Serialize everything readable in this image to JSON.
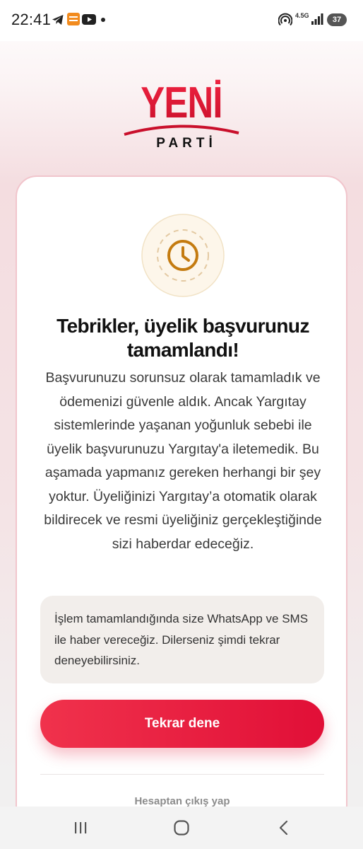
{
  "status_bar": {
    "time": "22:41",
    "network": "4.5G",
    "battery": "37",
    "icons": [
      "telegram-icon",
      "app-notification-icon",
      "youtube-icon",
      "hotspot-icon",
      "signal-icon"
    ]
  },
  "brand": {
    "name_top": "YENİ",
    "name_bottom": "PARTİ",
    "accent": "#e11d3a"
  },
  "card": {
    "status_icon": "clock-icon",
    "title": "Tebrikler, üyelik başvurunuz tamamlandı!",
    "message": "Başvurunuzu sorunsuz olarak tamamladık ve ödemenizi güvenle aldık. Ancak Yargıtay sistemlerinde yaşanan yoğunluk sebebi ile üyelik başvurunuzu Yargıtay'a iletemedik. Bu aşamada yapmanız gereken herhangi bir şey yoktur. Üyeliğinizi Yargıtay’a otomatik olarak bildirecek ve resmi üyeliğiniz gerçekleştiğinde sizi haberdar edeceğiz.",
    "notice": "İşlem tamamlandığında size WhatsApp ve SMS ile haber vereceğiz. Dilerseniz şimdi tekrar deneyebilirsiniz.",
    "retry_button": "Tekrar dene",
    "logout_link": "Hesaptan çıkış yap"
  },
  "nav_bar": {
    "recent_icon": "recent-apps-icon",
    "home_icon": "home-icon",
    "back_icon": "back-icon"
  }
}
